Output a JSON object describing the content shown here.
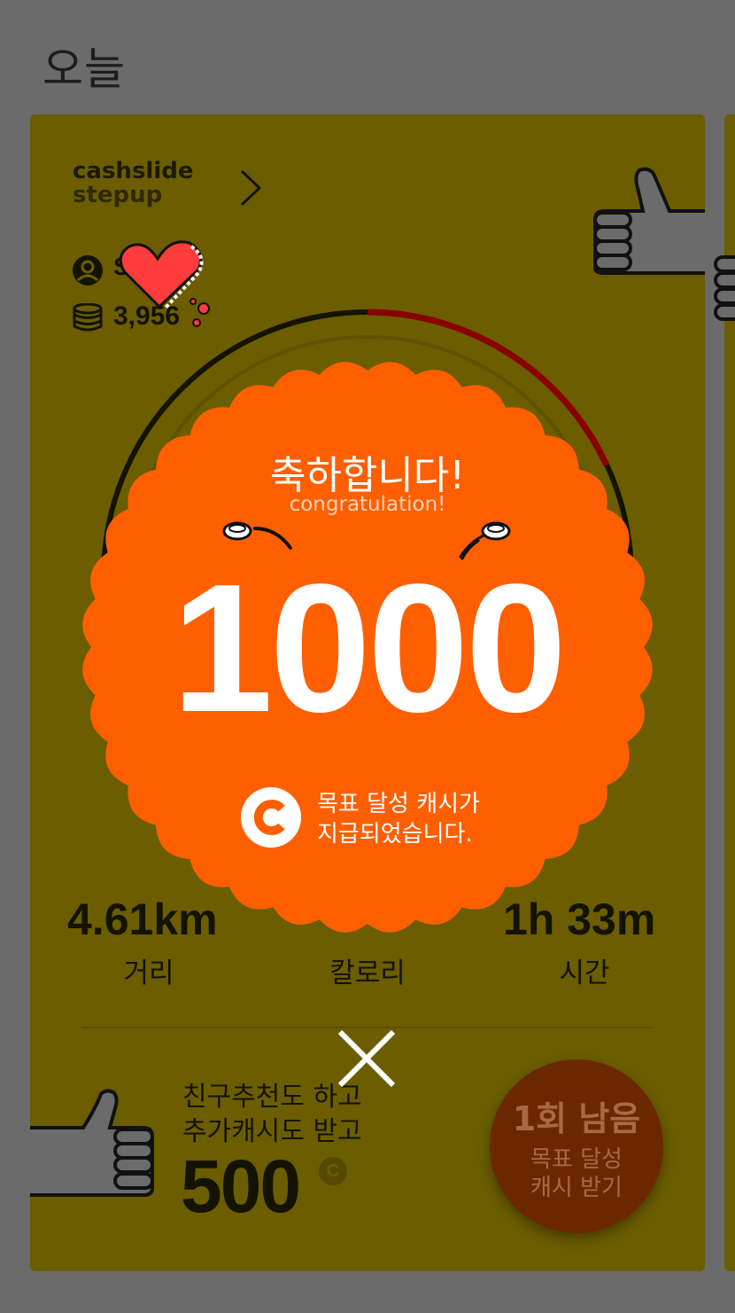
{
  "header": {
    "title": "오늘"
  },
  "card": {
    "brand_line1": "cashslide",
    "brand_line2": "stepup",
    "user_name": "S",
    "coin_balance": "3,956",
    "stats": [
      {
        "value": "4.61km",
        "label": "거리"
      },
      {
        "value": "",
        "label": "칼로리"
      },
      {
        "value": "1h 33m",
        "label": "시간"
      }
    ],
    "promo": {
      "line1": "친구추천도 하고",
      "line2": "추가캐시도 받고",
      "amount": "500",
      "currency_symbol": "C"
    },
    "claim_button": {
      "title": "1회 남음",
      "line1": "목표 달성",
      "line2": "캐시 받기"
    }
  },
  "popup": {
    "title_ko": "축하합니다!",
    "title_en": "congratulation!",
    "amount": "1000",
    "message_line1": "목표 달성 캐시가",
    "message_line2": "지급되었습니다.",
    "close_icon": "close-icon"
  },
  "icons": [
    "chevron-right-icon",
    "user-icon",
    "coins-icon",
    "heart-sticker-icon",
    "thumbs-up-icon",
    "cash-c-icon",
    "close-icon"
  ],
  "colors": {
    "dim_background": "#6b6b6b",
    "card_background": "#6b5d00",
    "burst_orange": "#ff5f00",
    "progress_red": "#8a0000",
    "claim_button": "#6b2800",
    "text_white": "#ffffff"
  }
}
